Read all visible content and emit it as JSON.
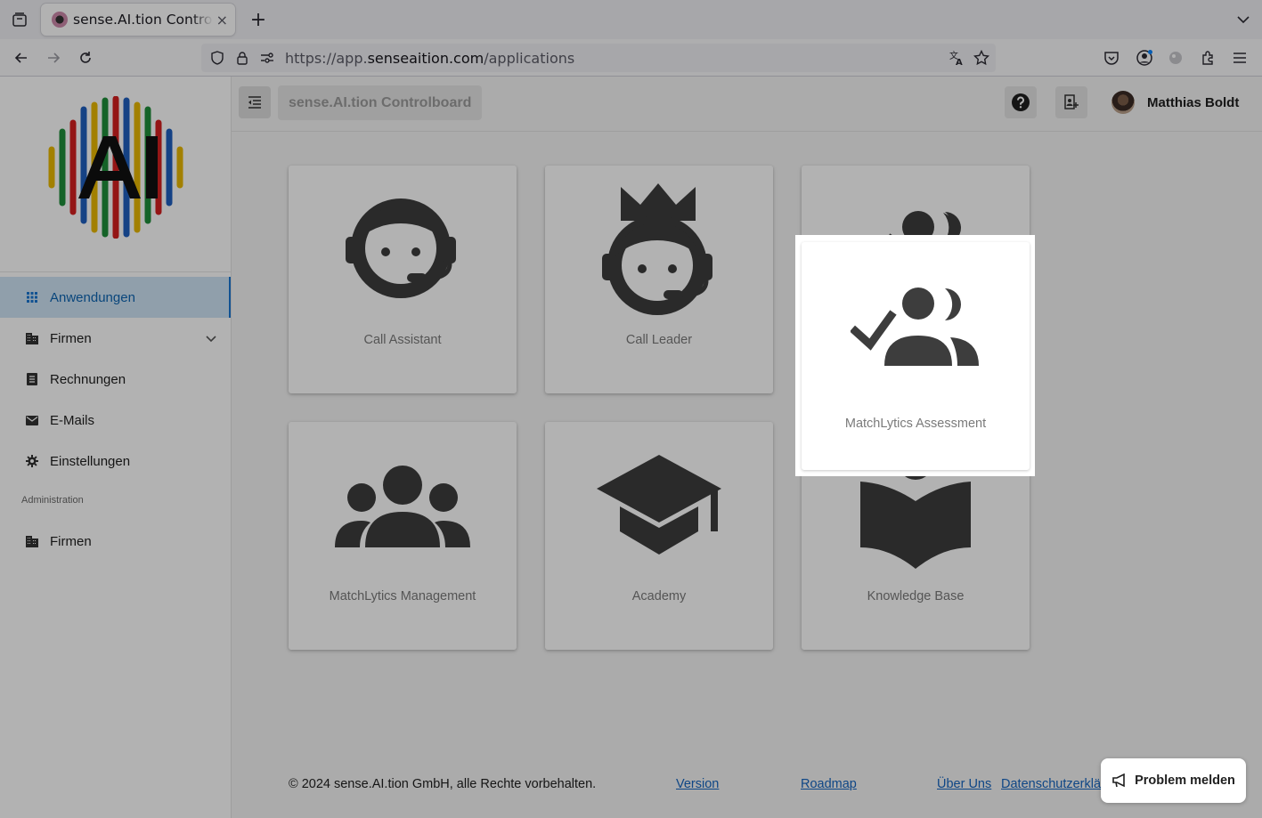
{
  "browser": {
    "tab_title": "sense.AI.tion Controlboard",
    "tab_close": "×",
    "new_tab": "+",
    "url_prefix": "https://app.",
    "url_domain": "senseaition.com",
    "url_path": "/applications"
  },
  "header": {
    "brand": "sense.AI.tion Controlboard",
    "user_name": "Matthias Boldt"
  },
  "sidebar": {
    "items": [
      {
        "label": "Anwendungen",
        "icon": "apps-grid-icon"
      },
      {
        "label": "Firmen",
        "icon": "building-icon"
      },
      {
        "label": "Rechnungen",
        "icon": "receipt-icon"
      },
      {
        "label": "E-Mails",
        "icon": "mail-icon"
      },
      {
        "label": "Einstellungen",
        "icon": "gear-icon"
      }
    ],
    "section_label": "Administration",
    "admin_items": [
      {
        "label": "Firmen",
        "icon": "building-icon"
      }
    ]
  },
  "apps": [
    {
      "label": "Call Assistant",
      "icon": "headset-agent-icon"
    },
    {
      "label": "Call Leader",
      "icon": "crowned-headset-agent-icon"
    },
    {
      "label": "MatchLytics Assessment",
      "icon": "group-check-icon"
    },
    {
      "label": "MatchLytics Management",
      "icon": "group-icon"
    },
    {
      "label": "Academy",
      "icon": "graduation-cap-icon"
    },
    {
      "label": "Knowledge Base",
      "icon": "reading-person-icon"
    }
  ],
  "footer": {
    "copyright": "© 2024 sense.AI.tion GmbH, alle Rechte vorbehalten.",
    "links": [
      "Version",
      "Roadmap",
      "Über Uns",
      "Datenschutzerklärung"
    ],
    "problem_button": "Problem melden"
  },
  "colors": {
    "accent": "#1976d2",
    "active_bg": "#cfe4f5",
    "icon_dark": "#3d3d3d"
  }
}
